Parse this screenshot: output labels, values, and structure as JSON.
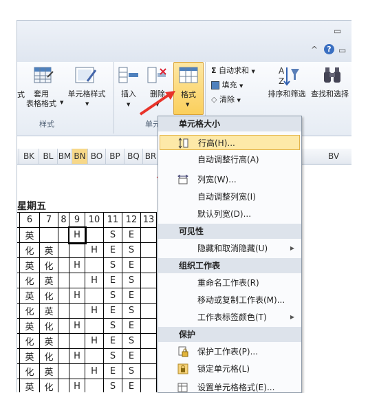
{
  "window": {
    "minimize_glyph": "▭",
    "help_glyph": "?",
    "chevron_glyph": "^"
  },
  "ribbon": {
    "style_group": {
      "label": "样式",
      "apply_table_format": "套用\n表格格式",
      "cell_styles": "单元格样式",
      "partial_left": "式"
    },
    "cells_group": {
      "label": "单元格",
      "insert": "插入",
      "delete": "删除",
      "format": "格式"
    },
    "edit_group": {
      "autosum": "自动求和",
      "fill": "填充",
      "clear": "清除",
      "sort_filter": "排序和筛选",
      "find_select": "查找和选择"
    }
  },
  "columns": [
    "BK",
    "BL",
    "BM",
    "BN",
    "BO",
    "BP",
    "BQ",
    "BR",
    "BV"
  ],
  "selected_column": "BN",
  "sheet": {
    "day_label": "星期五",
    "header_row": [
      "6",
      "7",
      "8",
      "9",
      "10",
      "11",
      "12",
      "13"
    ],
    "rows": [
      [
        "英",
        "",
        "",
        "H",
        "",
        "S",
        "E",
        ""
      ],
      [
        "化",
        "英",
        "",
        "",
        "H",
        "E",
        "S",
        ""
      ],
      [
        "英",
        "化",
        "",
        "H",
        "",
        "S",
        "E",
        ""
      ],
      [
        "化",
        "英",
        "",
        "",
        "H",
        "E",
        "S",
        ""
      ],
      [
        "英",
        "化",
        "",
        "H",
        "",
        "S",
        "E",
        ""
      ],
      [
        "化",
        "英",
        "",
        "",
        "H",
        "E",
        "S",
        ""
      ],
      [
        "英",
        "化",
        "",
        "H",
        "",
        "S",
        "E",
        ""
      ],
      [
        "化",
        "英",
        "",
        "",
        "H",
        "E",
        "S",
        ""
      ],
      [
        "英",
        "化",
        "",
        "H",
        "",
        "S",
        "E",
        ""
      ],
      [
        "化",
        "英",
        "",
        "",
        "H",
        "E",
        "S",
        ""
      ],
      [
        "英",
        "化",
        "",
        "H",
        "",
        "S",
        "E",
        ""
      ]
    ]
  },
  "format_menu": {
    "cell_size_header": "单元格大小",
    "row_height": "行高(H)...",
    "autofit_row_height": "自动调整行高(A)",
    "column_width": "列宽(W)...",
    "autofit_column_width": "自动调整列宽(I)",
    "default_width": "默认列宽(D)...",
    "visibility_header": "可见性",
    "hide_unhide": "隐藏和取消隐藏(U)",
    "organize_header": "组织工作表",
    "rename_sheet": "重命名工作表(R)",
    "move_copy_sheet": "移动或复制工作表(M)...",
    "tab_color": "工作表标签颜色(T)",
    "protection_header": "保护",
    "protect_sheet": "保护工作表(P)...",
    "lock_cell": "锁定单元格(L)",
    "format_cells": "设置单元格格式(E)..."
  },
  "colors": {
    "highlight": "#fde9a8",
    "arrow": "#e8332a",
    "format_button": "#fbd46a"
  }
}
